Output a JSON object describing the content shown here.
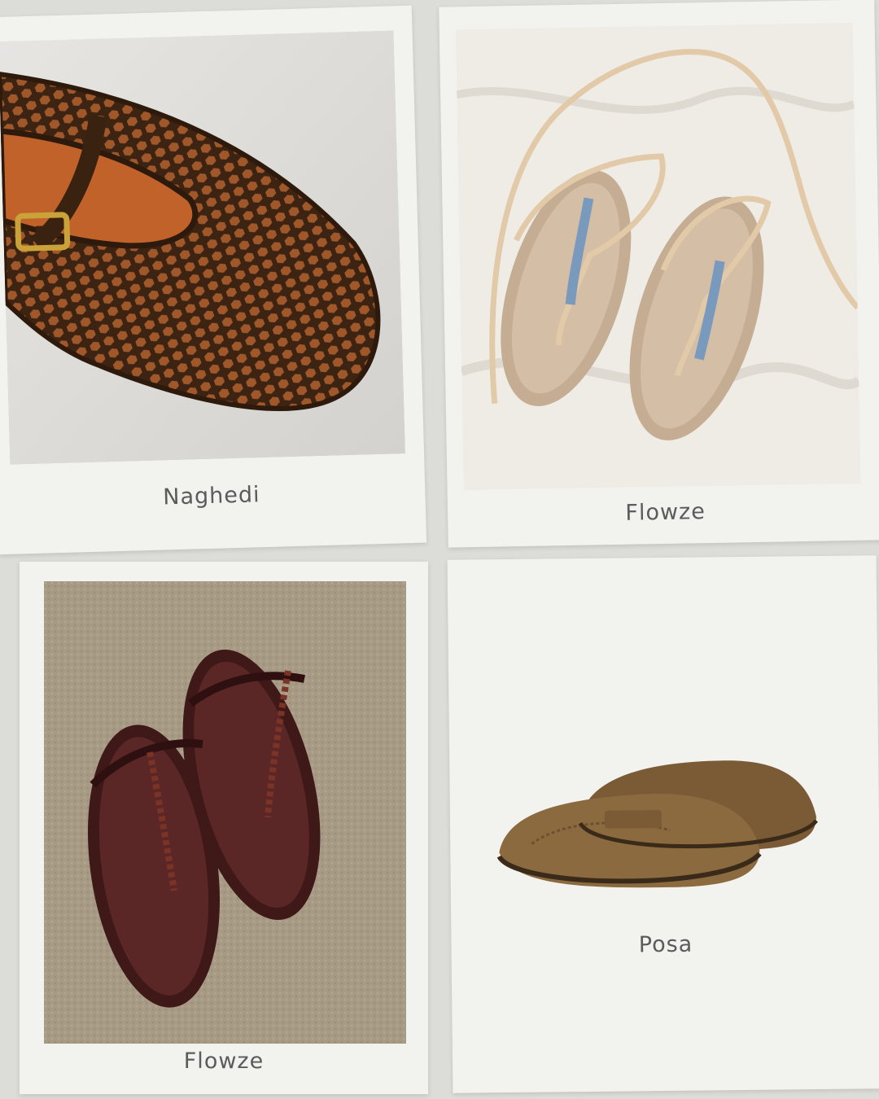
{
  "cards": [
    {
      "caption": "Naghedi",
      "image": "brown-woven-mary-jane-flat-photo"
    },
    {
      "caption": "Flowze",
      "image": "beige-rope-tie-sandals-photo"
    },
    {
      "caption": "Flowze",
      "image": "burgundy-rope-thong-sandals-photo"
    },
    {
      "caption": "Posa",
      "image": "olive-suede-penny-loafers-photo"
    }
  ],
  "colors": {
    "background": "#dcdcd8",
    "card": "#f2f2ef",
    "caption_text": "#5b5b5b",
    "woven_leather": "#4a2a16",
    "sandal_beige": "#cbb49a",
    "sandal_burgundy": "#4e2020",
    "suede_olive": "#8a6a40"
  }
}
